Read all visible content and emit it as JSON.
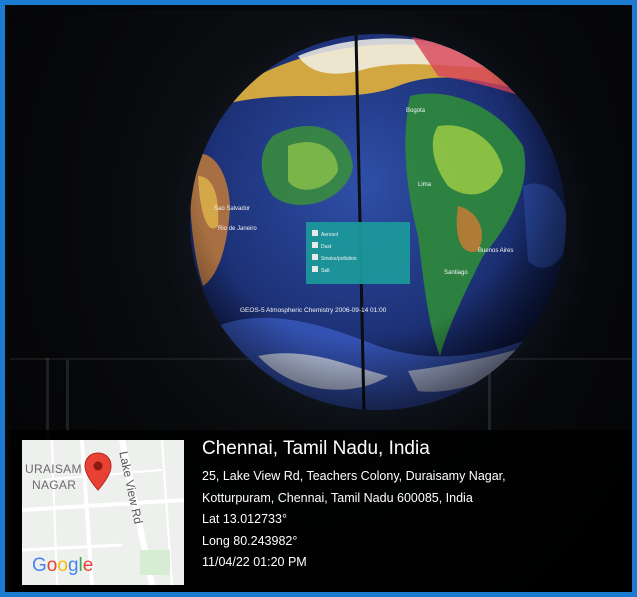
{
  "photo": {
    "frame_color": "#1b7bd0",
    "subject": "globe-projection",
    "globe_labels": {
      "city_left_1": "Sao Salvador",
      "city_left_2": "Rio de Janeiro",
      "city_right_1": "Bogota",
      "city_right_2": "Lima",
      "city_right_3": "Buenos Aires",
      "city_right_4": "Santiago",
      "caption": "GEOS-5 Atmospheric Chemistry 2006-09-14 01:00",
      "legend_items": [
        "Aerosol",
        "Dust",
        "Smoke/pollution",
        "Salt"
      ]
    }
  },
  "geotag": {
    "title": "Chennai, Tamil Nadu, India",
    "address_line_1": "25, Lake View Rd, Teachers Colony, Duraisamy Nagar,",
    "address_line_2": "Kotturpuram, Chennai, Tamil Nadu 600085, India",
    "latitude": "Lat 13.012733°",
    "longitude": "Long 80.243982°",
    "datetime": "11/04/22 01:20 PM",
    "map": {
      "area_label_1": "URAISAM",
      "area_label_2": "NAGAR",
      "road_label": "Lake View Rd",
      "logo": "Google",
      "pin_icon": "map-pin-icon",
      "pin_color": "#e94235"
    }
  }
}
